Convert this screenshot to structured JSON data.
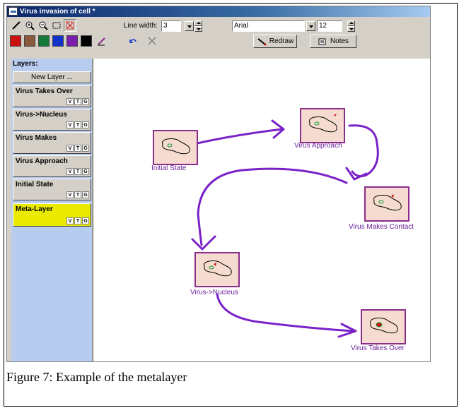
{
  "window": {
    "title": "Virus invasion of cell *"
  },
  "toolbar": {
    "line_width_label": "Line width:",
    "line_width_value": "3",
    "font_value": "Arial",
    "font_size_value": "12",
    "redraw_label": "Redraw",
    "notes_label": "Notes",
    "colors": [
      "#cc1111",
      "#8b5a3c",
      "#137a3a",
      "#1133cc",
      "#7a1fb0",
      "#000000"
    ]
  },
  "sidebar": {
    "title": "Layers:",
    "new_layer_label": "New Layer ...",
    "layers": [
      {
        "name": "Virus Takes Over"
      },
      {
        "name": "Virus->Nucleus"
      },
      {
        "name": "Virus Makes"
      },
      {
        "name": "Virus Approach"
      },
      {
        "name": "Initial State"
      },
      {
        "name": "Meta-Layer",
        "active": true
      }
    ],
    "flag_v": "V",
    "flag_t": "T",
    "flag_g": "G"
  },
  "canvas": {
    "nodes": [
      {
        "label": "Initial State",
        "accent": "#8b2d8b"
      },
      {
        "label": "Virus Approach",
        "accent": "#8b2d8b"
      },
      {
        "label": "Virus Makes Contact",
        "accent": "#8b2d8b"
      },
      {
        "label": "Virus->Nucleus",
        "accent": "#8b2d8b"
      },
      {
        "label": "Virus Takes Over",
        "accent": "#8b2d8b"
      }
    ],
    "arrow_color": "#7a22c8"
  },
  "caption": "Figure 7: Example of the metalayer"
}
